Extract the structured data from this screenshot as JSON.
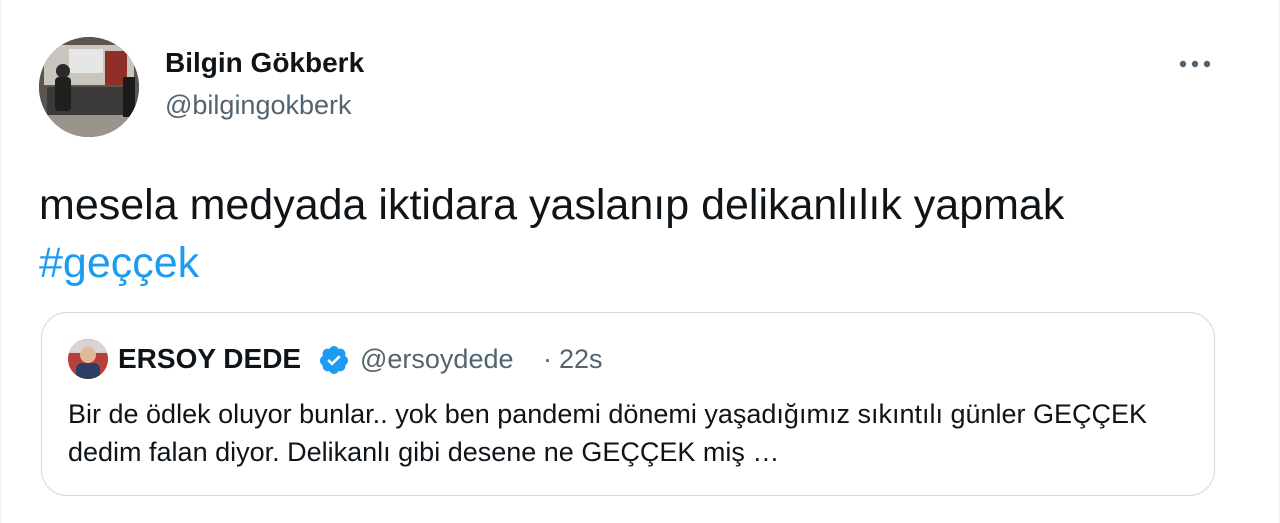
{
  "author": {
    "name": "Bilgin Gökberk",
    "handle": "@bilgingokberk"
  },
  "more_icon": "ellipsis-icon",
  "tweet": {
    "text": "mesela medyada iktidara yaslanıp delikanlılık yapmak",
    "hashtag": "#geççek"
  },
  "quote": {
    "name": "ERSOY DEDE",
    "verified_icon": "verified-badge-icon",
    "handle": "@ersoydede",
    "separator": "·",
    "time": "22s",
    "text": "Bir de ödlek oluyor bunlar.. yok ben pandemi dönemi yaşadığımız sıkıntılı günler GEÇÇEK dedim falan diyor. Delikanlı gibi desene ne GEÇÇEK miş …"
  },
  "colors": {
    "text": "#0f1419",
    "secondary": "#536471",
    "link": "#1d9bf0",
    "verified": "#1d9bf0",
    "border": "#cfd9de"
  }
}
